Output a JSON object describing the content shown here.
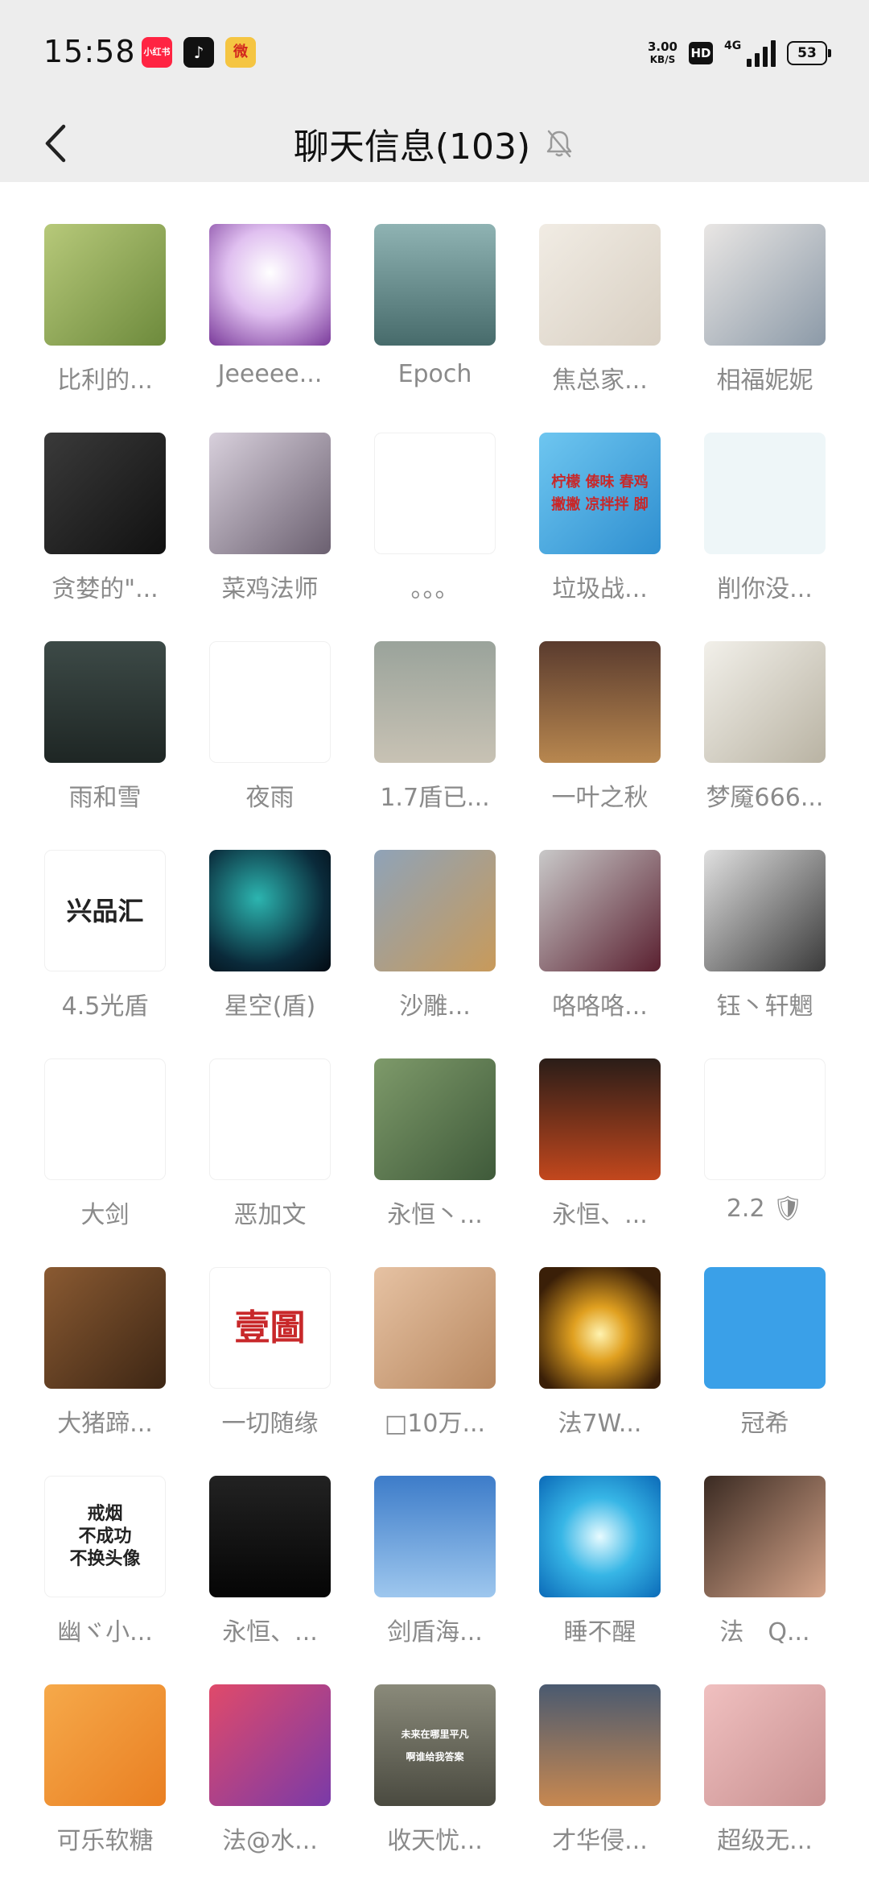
{
  "status_bar": {
    "time": "15:58",
    "apps": [
      {
        "name": "xiaohongshu-app-icon",
        "label": "小红书",
        "color": "#ff2442"
      },
      {
        "name": "douyin-app-icon",
        "label": "♪",
        "color": "#111111"
      },
      {
        "name": "weibo-app-icon",
        "label": "微",
        "color": "#f5c542"
      }
    ],
    "speed_value": "3.00",
    "speed_unit": "KB/S",
    "hd_label": "HD",
    "network": "4G",
    "battery": "53"
  },
  "header": {
    "title": "聊天信息(103)"
  },
  "members": [
    {
      "name": "比利的...",
      "bg": "linear-gradient(135deg,#b7c97a,#6d8a3c)",
      "icon": "frog-kid-avatar"
    },
    {
      "name": "Jeeeee...",
      "bg": "radial-gradient(circle at 50% 40%,#ffffff,#e0c0f0 45%,#7a3a9a)",
      "icon": "silhouette-avatar"
    },
    {
      "name": "Epoch",
      "bg": "linear-gradient(180deg,#8fb3b3,#476b6b)",
      "icon": "landscape-avatar"
    },
    {
      "name": "焦总家...",
      "bg": "linear-gradient(135deg,#f1ece4,#d8cfc2)",
      "icon": "beads-avatar"
    },
    {
      "name": "相福妮妮",
      "bg": "linear-gradient(135deg,#e9e6e4,#8c9aa8)",
      "icon": "girl-avatar"
    },
    {
      "name": "贪婪的\"...",
      "bg": "linear-gradient(135deg,#3a3a3a,#111111)",
      "icon": "car-man-avatar"
    },
    {
      "name": "菜鸡法师",
      "bg": "linear-gradient(135deg,#d8d0dc,#6b6070)",
      "icon": "anime-star-avatar"
    },
    {
      "name": "。。。",
      "bg": "#ffffff",
      "icon": "qr-code-avatar"
    },
    {
      "name": "垃圾战...",
      "bg": "linear-gradient(135deg,#6ec6f0,#2f8fd0)",
      "icon": "food-sign-avatar",
      "text": "柠檬 傣味 春鸡\n撇撇 凉拌拌 脚"
    },
    {
      "name": "削你没...",
      "bg": "#eef6f8",
      "icon": "joker-avatar"
    },
    {
      "name": "雨和雪",
      "bg": "linear-gradient(180deg,#3d4a47,#1e2624)",
      "icon": "back-girl-avatar"
    },
    {
      "name": "夜雨",
      "bg": "#ffffff",
      "icon": "wolf-cartoon-avatar"
    },
    {
      "name": "1.7盾已...",
      "bg": "linear-gradient(180deg,#9aa39b,#c8c2b4)",
      "icon": "couple-bridge-avatar"
    },
    {
      "name": "一叶之秋",
      "bg": "linear-gradient(180deg,#5a3b2e,#b8874f)",
      "icon": "sunset-tree-avatar"
    },
    {
      "name": "梦魇666...",
      "bg": "linear-gradient(135deg,#f2f0ea,#b9b3a3)",
      "icon": "soldier-avatar"
    },
    {
      "name": "4.5光盾",
      "bg": "#ffffff",
      "icon": "xingpinhui-logo-avatar",
      "text": "兴品汇"
    },
    {
      "name": "星空(盾)",
      "bg": "radial-gradient(circle at 40% 40%,#2cb5b0,#0a2a3a 65%,#030a12)",
      "icon": "nebula-avatar"
    },
    {
      "name": "沙雕...",
      "bg": "linear-gradient(135deg,#8fa3b8,#c89a5a)",
      "icon": "shiba-dog-avatar"
    },
    {
      "name": "咯咯咯...",
      "bg": "linear-gradient(135deg,#c9c9c9,#5a2030)",
      "icon": "boy-selfie-avatar"
    },
    {
      "name": "钰丶轩魍",
      "bg": "linear-gradient(135deg,#e0e0e0,#3a3a3a)",
      "icon": "masked-boy-avatar"
    },
    {
      "name": "大剑",
      "bg": "#ffffff",
      "icon": "lucky-mouse-avatar"
    },
    {
      "name": "恶加文",
      "bg": "#ffffff",
      "icon": "antler-hat-avatar"
    },
    {
      "name": "永恒丶...",
      "bg": "linear-gradient(135deg,#7e9a6a,#3f5a3a)",
      "icon": "cards-avatar"
    },
    {
      "name": "永恒、...",
      "bg": "linear-gradient(180deg,#2a1d18,#c2471d)",
      "icon": "robot-fire-avatar"
    },
    {
      "name": "2.2 🛡",
      "bg": "#ffffff",
      "icon": "anime-boy-avatar"
    },
    {
      "name": "大猪蹄...",
      "bg": "linear-gradient(135deg,#8a5a32,#3d2614)",
      "icon": "beast-avatar"
    },
    {
      "name": "一切随缘",
      "bg": "#ffffff",
      "icon": "red-seal-avatar",
      "text": "壹圖"
    },
    {
      "name": "□10万...",
      "bg": "linear-gradient(135deg,#e6c2a3,#b88860)",
      "icon": "glasses-hamster-avatar"
    },
    {
      "name": "法7W...",
      "bg": "radial-gradient(circle at 50% 55%,#fff3b0,#e0a020 30%,#3a1f08 80%)",
      "icon": "sun-hand-avatar"
    },
    {
      "name": "冠希",
      "bg": "#3aa0e8",
      "icon": "patrick-star-avatar"
    },
    {
      "name": "幽ヾ小...",
      "bg": "#ffffff",
      "icon": "no-smoking-avatar",
      "text": "戒烟\n不成功\n不换头像"
    },
    {
      "name": "永恒、...",
      "bg": "linear-gradient(180deg,#222222,#050505)",
      "icon": "suit-man-avatar"
    },
    {
      "name": "剑盾海...",
      "bg": "linear-gradient(180deg,#3d7cc9,#9ec7ee)",
      "icon": "diver-avatar"
    },
    {
      "name": "睡不醒",
      "bg": "radial-gradient(circle at 50% 50%,#e8fbff,#37b6e6 45%,#0b6ab8)",
      "icon": "water-earth-avatar"
    },
    {
      "name": "法　Q...",
      "bg": "linear-gradient(135deg,#3a2a22,#d6a58a)",
      "icon": "lying-girl-avatar"
    },
    {
      "name": "可乐软糖",
      "bg": "linear-gradient(135deg,#f6a94a,#e97f22)",
      "icon": "couple-cartoon-avatar"
    },
    {
      "name": "法@水...",
      "bg": "linear-gradient(135deg,#e04a6a,#7a3aa8)",
      "icon": "anime-girl-avatar"
    },
    {
      "name": "收天忧...",
      "bg": "linear-gradient(180deg,#8a8a7a,#4a4a40)",
      "icon": "street-avatar",
      "text": "未来在哪里平凡\n啊谁给我答案"
    },
    {
      "name": "才华侵...",
      "bg": "linear-gradient(180deg,#4a5a70,#c88850)",
      "icon": "hero-silhouette-avatar"
    },
    {
      "name": "超级无...",
      "bg": "linear-gradient(135deg,#f0c0c0,#c89090)",
      "icon": "jerry-mouse-avatar"
    }
  ]
}
